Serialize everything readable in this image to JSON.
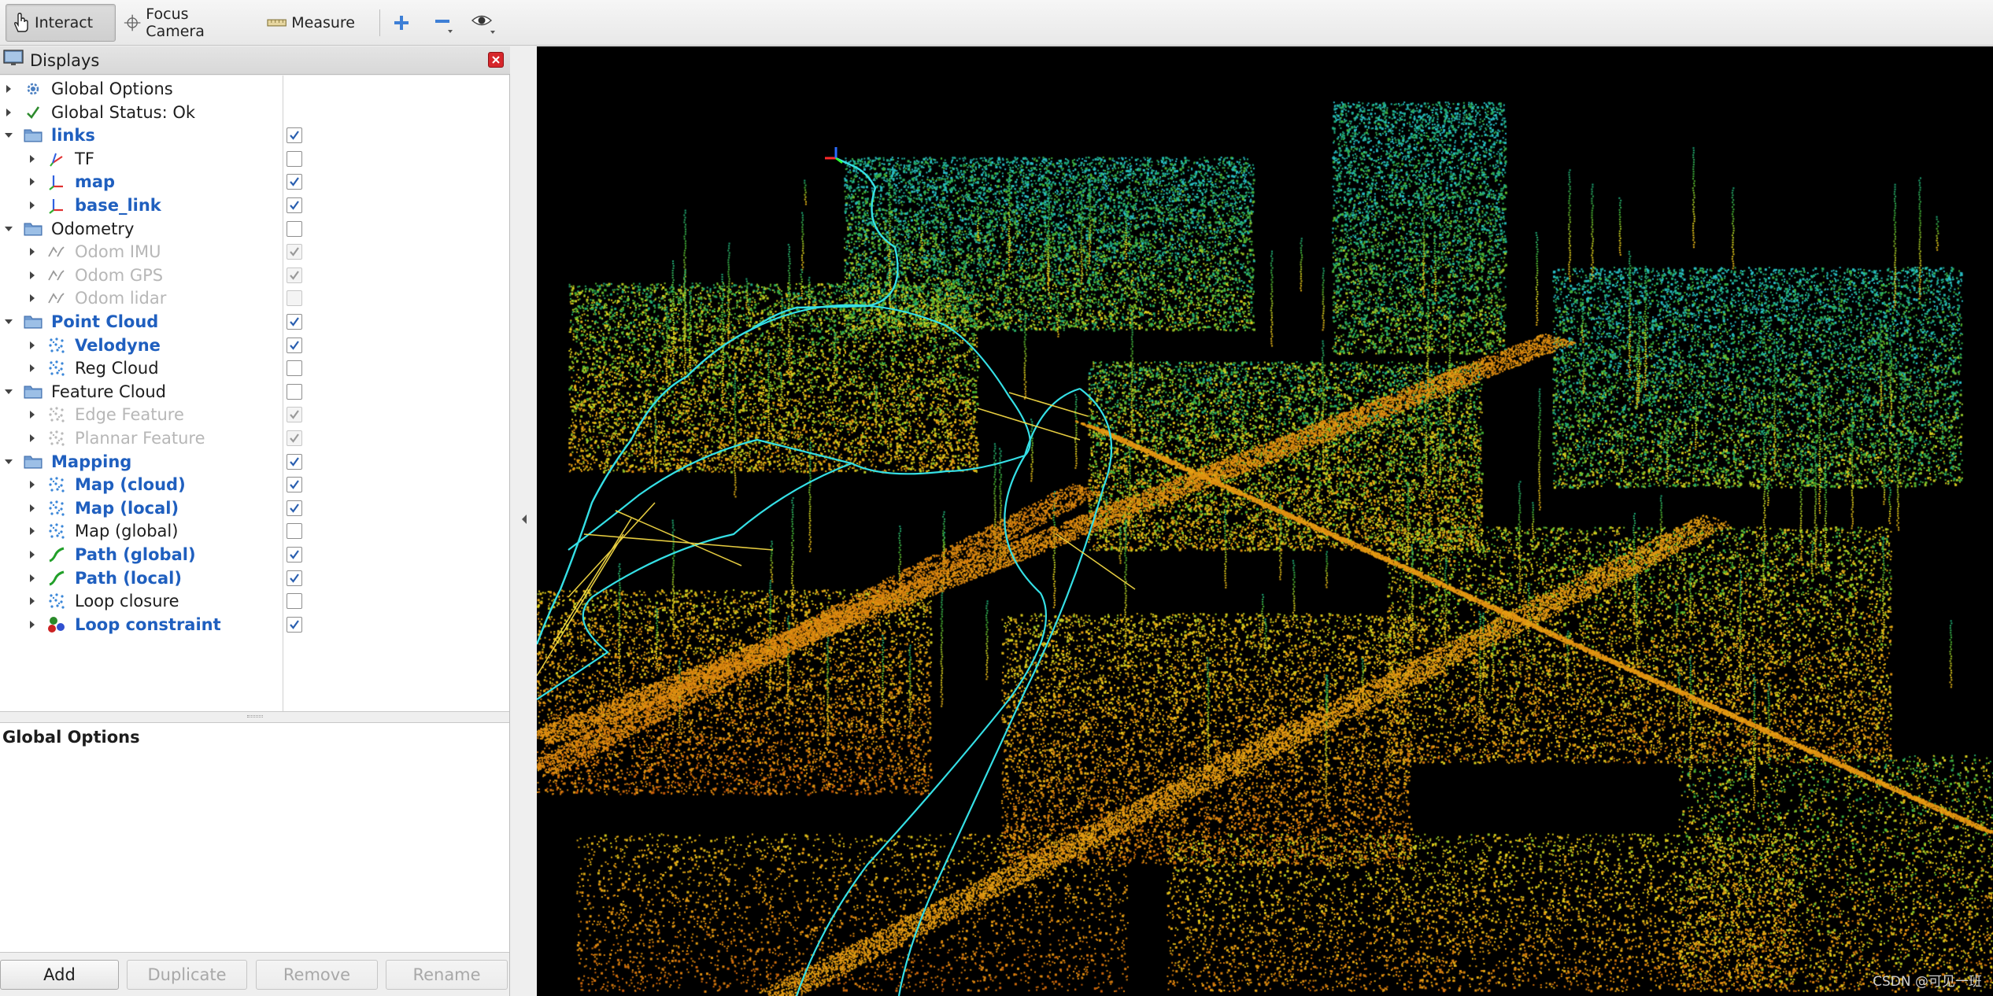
{
  "toolbar": {
    "interact_label": "Interact",
    "focus_camera_label": "Focus Camera",
    "measure_label": "Measure"
  },
  "displays": {
    "title": "Displays",
    "items": [
      {
        "label": "Global Options",
        "icon": "gear-icon",
        "expanded": false,
        "checked": null,
        "style": "normal",
        "level": 0
      },
      {
        "label": "Global Status: Ok",
        "icon": "check-icon",
        "expanded": false,
        "checked": null,
        "style": "normal",
        "level": 0
      },
      {
        "label": "links",
        "icon": "folder-icon",
        "expanded": true,
        "checked": true,
        "style": "blue",
        "level": 0
      },
      {
        "label": "TF",
        "icon": "tf-icon",
        "expanded": false,
        "checked": false,
        "style": "normal",
        "level": 1
      },
      {
        "label": "map",
        "icon": "axes-icon",
        "expanded": false,
        "checked": true,
        "style": "blue",
        "level": 1
      },
      {
        "label": "base_link",
        "icon": "axes-icon",
        "expanded": false,
        "checked": true,
        "style": "blue",
        "level": 1
      },
      {
        "label": "Odometry",
        "icon": "folder-icon",
        "expanded": true,
        "checked": false,
        "style": "normal",
        "level": 0
      },
      {
        "label": "Odom IMU",
        "icon": "odometry-icon",
        "expanded": false,
        "checked": true,
        "style": "disabled",
        "level": 1
      },
      {
        "label": "Odom GPS",
        "icon": "odometry-icon",
        "expanded": false,
        "checked": true,
        "style": "disabled",
        "level": 1
      },
      {
        "label": "Odom lidar",
        "icon": "odometry-icon",
        "expanded": false,
        "checked": false,
        "style": "disabled",
        "level": 1
      },
      {
        "label": "Point Cloud",
        "icon": "folder-icon",
        "expanded": true,
        "checked": true,
        "style": "blue",
        "level": 0
      },
      {
        "label": "Velodyne",
        "icon": "pointcloud-icon",
        "expanded": false,
        "checked": true,
        "style": "blue",
        "level": 1
      },
      {
        "label": "Reg Cloud",
        "icon": "pointcloud-icon",
        "expanded": false,
        "checked": false,
        "style": "normal",
        "level": 1
      },
      {
        "label": "Feature Cloud",
        "icon": "folder-icon",
        "expanded": true,
        "checked": false,
        "style": "normal",
        "level": 0
      },
      {
        "label": "Edge Feature",
        "icon": "pointcloud-icon",
        "expanded": false,
        "checked": true,
        "style": "disabled",
        "level": 1
      },
      {
        "label": "Plannar Feature",
        "icon": "pointcloud-icon",
        "expanded": false,
        "checked": true,
        "style": "disabled",
        "level": 1
      },
      {
        "label": "Mapping",
        "icon": "folder-icon",
        "expanded": true,
        "checked": true,
        "style": "blue",
        "level": 0
      },
      {
        "label": "Map (cloud)",
        "icon": "pointcloud-icon",
        "expanded": false,
        "checked": true,
        "style": "blue",
        "level": 1
      },
      {
        "label": "Map (local)",
        "icon": "pointcloud-icon",
        "expanded": false,
        "checked": true,
        "style": "blue",
        "level": 1
      },
      {
        "label": "Map (global)",
        "icon": "pointcloud-icon",
        "expanded": false,
        "checked": false,
        "style": "normal",
        "level": 1
      },
      {
        "label": "Path (global)",
        "icon": "path-icon",
        "expanded": false,
        "checked": true,
        "style": "blue",
        "level": 1
      },
      {
        "label": "Path (local)",
        "icon": "path-icon",
        "expanded": false,
        "checked": true,
        "style": "blue",
        "level": 1
      },
      {
        "label": "Loop closure",
        "icon": "pointcloud-icon",
        "expanded": false,
        "checked": false,
        "style": "normal",
        "level": 1
      },
      {
        "label": "Loop constraint",
        "icon": "marker-icon",
        "expanded": false,
        "checked": true,
        "style": "blue",
        "level": 1
      }
    ]
  },
  "properties": {
    "title": "Global Options"
  },
  "buttons": {
    "add": "Add",
    "duplicate": "Duplicate",
    "remove": "Remove",
    "rename": "Rename"
  },
  "view": {
    "watermark": "CSDN @可见一班"
  },
  "colors": {
    "accent_blue": "#1f5fbf",
    "path_cyan": "#35e0e6",
    "close_red": "#d7262b"
  }
}
